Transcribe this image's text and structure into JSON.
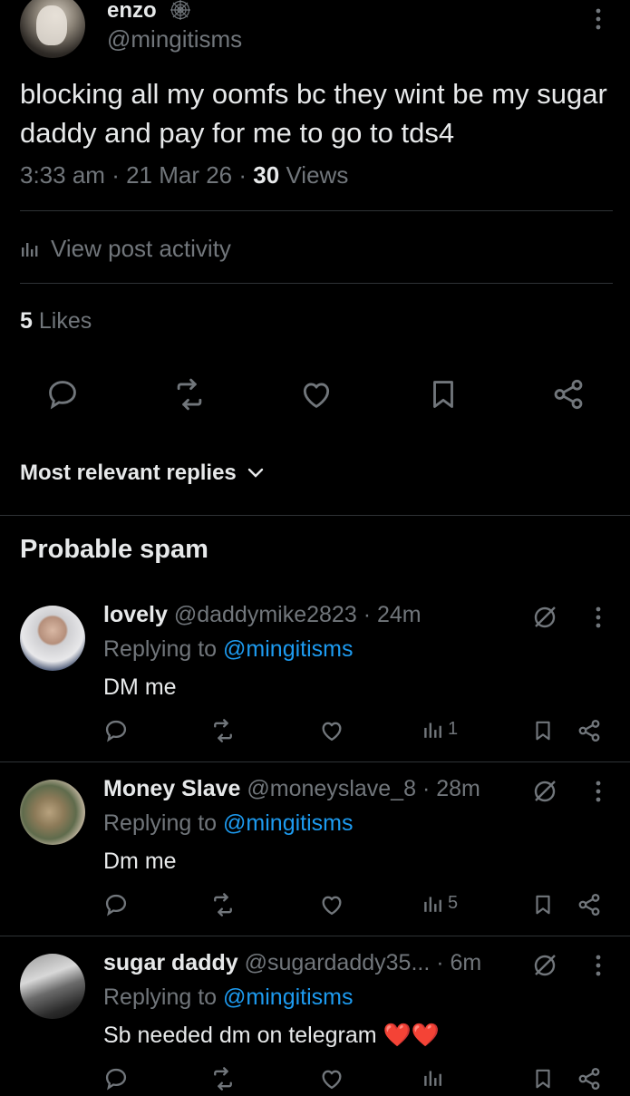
{
  "post": {
    "author_name": "enzo",
    "author_handle": "@mingitisms",
    "text": "blocking all my oomfs bc they wint be my sugar daddy and pay for me to go to tds4",
    "time": "3:33 am",
    "date": "21 Mar 26",
    "views_count": "30",
    "views_label": "Views",
    "activity_label": "View post activity",
    "likes_count": "5",
    "likes_label": "Likes"
  },
  "sort_label": "Most relevant replies",
  "spam_section_title": "Probable spam",
  "replying_to_label": "Replying to",
  "replies": [
    {
      "name": "lovely",
      "handle": "@daddymike2823",
      "time": "24m",
      "replying_to": "@mingitisms",
      "text": "DM me",
      "views": "1"
    },
    {
      "name": "Money Slave",
      "handle": "@moneyslave_8",
      "time": "28m",
      "replying_to": "@mingitisms",
      "text": "Dm me",
      "views": "5"
    },
    {
      "name": "sugar daddy",
      "handle": "@sugardaddy35...",
      "time": "6m",
      "replying_to": "@mingitisms",
      "text": "Sb needed dm on telegram",
      "emoji": "❤️❤️",
      "views": ""
    }
  ],
  "icons": {
    "main_actions": [
      "reply-icon",
      "repost-icon",
      "like-icon",
      "bookmark-icon",
      "share-icon"
    ],
    "reply_actions": [
      "reply-icon",
      "repost-icon",
      "like-icon",
      "views-icon",
      "bookmark-icon",
      "share-icon"
    ]
  },
  "colors": {
    "background": "#000000",
    "text": "#e7e9ea",
    "muted": "#71767b",
    "link": "#1d9bf0",
    "divider": "#2f3336",
    "heart": "#f91880"
  }
}
